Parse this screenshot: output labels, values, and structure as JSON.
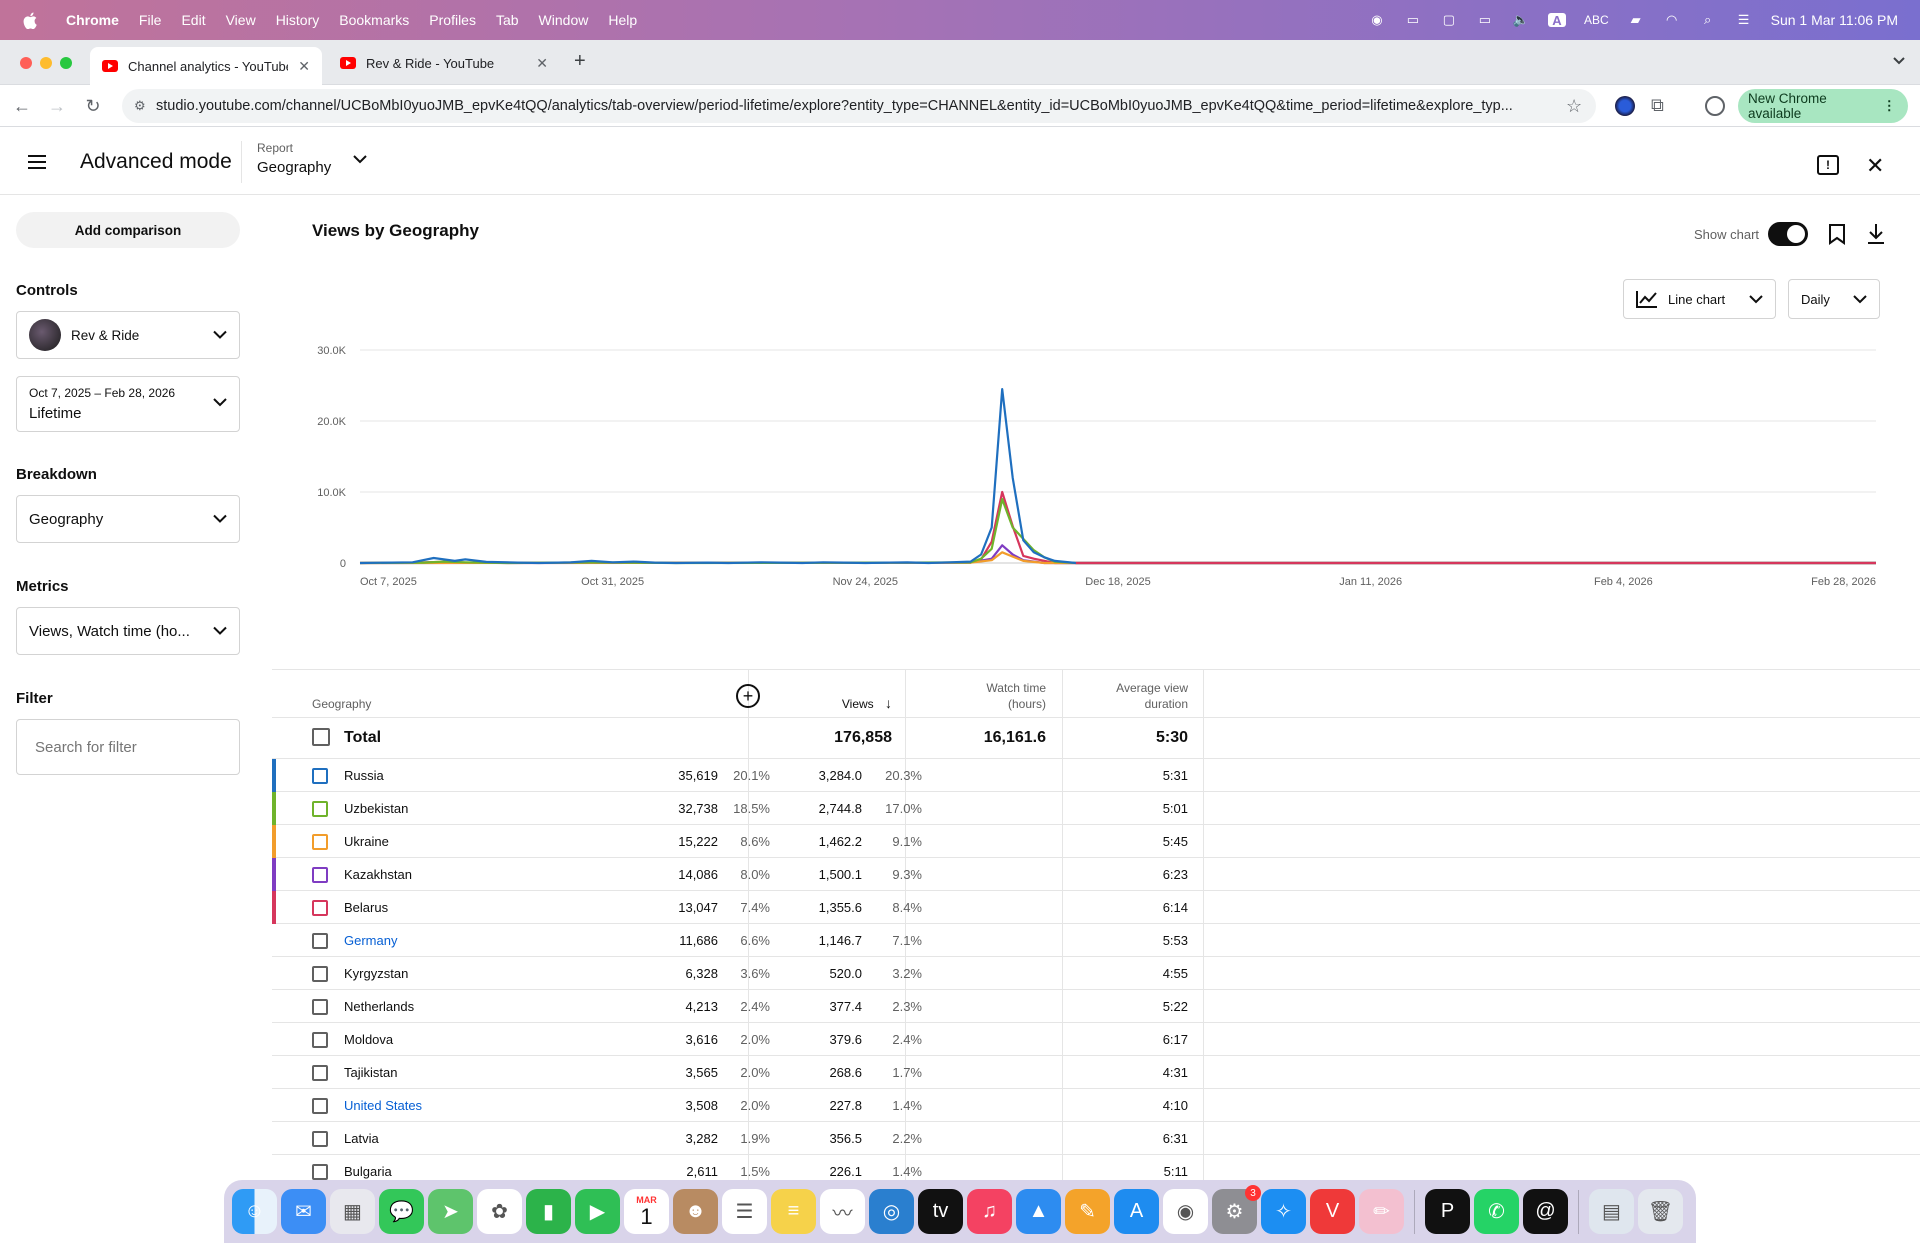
{
  "menubar": {
    "app": "Chrome",
    "items": [
      "File",
      "Edit",
      "View",
      "History",
      "Bookmarks",
      "Profiles",
      "Tab",
      "Window",
      "Help"
    ],
    "input_source": "ABC",
    "clock": "Sun 1 Mar  11:06 PM"
  },
  "tabs": [
    {
      "title": "Channel analytics - YouTube S"
    },
    {
      "title": "Rev & Ride - YouTube"
    }
  ],
  "address": {
    "url": "studio.youtube.com/channel/UCBoMbI0yuoJMB_epvKe4tQQ/analytics/tab-overview/period-lifetime/explore?entity_type=CHANNEL&entity_id=UCBoMbI0yuoJMB_epvKe4tQQ&time_period=lifetime&explore_typ...",
    "new_chrome": "New Chrome available"
  },
  "header": {
    "title": "Advanced mode",
    "report_label": "Report",
    "report_value": "Geography"
  },
  "sidebar": {
    "add_comparison": "Add comparison",
    "controls_heading": "Controls",
    "channel": "Rev & Ride",
    "date_range": "Oct 7, 2025 – Feb 28, 2026",
    "period": "Lifetime",
    "breakdown_heading": "Breakdown",
    "breakdown_value": "Geography",
    "metrics_heading": "Metrics",
    "metrics_value": "Views, Watch time (ho...",
    "filter_heading": "Filter",
    "filter_placeholder": "Search for filter"
  },
  "chart_header": {
    "title": "Views by Geography",
    "show_chart": "Show chart",
    "chart_type": "Line chart",
    "granularity": "Daily"
  },
  "chart_data": {
    "type": "line",
    "y_ticks": [
      "30.0K",
      "20.0K",
      "10.0K",
      "0"
    ],
    "ylim": [
      0,
      30000
    ],
    "x_ticks": [
      "Oct 7, 2025",
      "Oct 31, 2025",
      "Nov 24, 2025",
      "Dec 18, 2025",
      "Jan 11, 2026",
      "Feb 4, 2026",
      "Feb 28, 2026"
    ],
    "x_range_days": [
      0,
      144
    ],
    "series": [
      {
        "name": "Russia",
        "color": "#1f6fbf",
        "points": [
          [
            0,
            0
          ],
          [
            5,
            100
          ],
          [
            7,
            700
          ],
          [
            9,
            300
          ],
          [
            10,
            500
          ],
          [
            12,
            150
          ],
          [
            15,
            50
          ],
          [
            17,
            0
          ],
          [
            20,
            80
          ],
          [
            22,
            300
          ],
          [
            24,
            100
          ],
          [
            26,
            200
          ],
          [
            28,
            50
          ],
          [
            30,
            0
          ],
          [
            33,
            50
          ],
          [
            35,
            0
          ],
          [
            38,
            100
          ],
          [
            40,
            50
          ],
          [
            42,
            0
          ],
          [
            44,
            100
          ],
          [
            46,
            50
          ],
          [
            48,
            0
          ],
          [
            50,
            60
          ],
          [
            52,
            80
          ],
          [
            54,
            0
          ],
          [
            56,
            100
          ],
          [
            58,
            200
          ],
          [
            59,
            1200
          ],
          [
            60,
            5000
          ],
          [
            61,
            24500
          ],
          [
            62,
            12000
          ],
          [
            63,
            3200
          ],
          [
            64,
            1500
          ],
          [
            65,
            800
          ],
          [
            66,
            300
          ],
          [
            68,
            0
          ],
          [
            144,
            0
          ]
        ]
      },
      {
        "name": "Uzbekistan",
        "color": "#6fb32b",
        "points": [
          [
            0,
            0
          ],
          [
            6,
            60
          ],
          [
            8,
            200
          ],
          [
            10,
            100
          ],
          [
            14,
            0
          ],
          [
            22,
            80
          ],
          [
            26,
            50
          ],
          [
            30,
            0
          ],
          [
            52,
            50
          ],
          [
            58,
            80
          ],
          [
            59,
            600
          ],
          [
            60,
            2000
          ],
          [
            61,
            9000
          ],
          [
            62,
            5000
          ],
          [
            63,
            3400
          ],
          [
            64,
            1800
          ],
          [
            65,
            800
          ],
          [
            66,
            200
          ],
          [
            68,
            0
          ],
          [
            144,
            0
          ]
        ]
      },
      {
        "name": "Ukraine",
        "color": "#f29d2b",
        "points": [
          [
            0,
            0
          ],
          [
            58,
            50
          ],
          [
            60,
            400
          ],
          [
            61,
            1500
          ],
          [
            62,
            900
          ],
          [
            63,
            300
          ],
          [
            65,
            0
          ],
          [
            144,
            0
          ]
        ]
      },
      {
        "name": "Kazakhstan",
        "color": "#7f3cc2",
        "points": [
          [
            0,
            0
          ],
          [
            58,
            50
          ],
          [
            60,
            600
          ],
          [
            61,
            2500
          ],
          [
            62,
            1200
          ],
          [
            63,
            400
          ],
          [
            65,
            0
          ],
          [
            144,
            0
          ]
        ]
      },
      {
        "name": "Belarus",
        "color": "#d6365c",
        "points": [
          [
            0,
            0
          ],
          [
            5,
            50
          ],
          [
            8,
            150
          ],
          [
            10,
            50
          ],
          [
            14,
            0
          ],
          [
            58,
            50
          ],
          [
            59,
            500
          ],
          [
            60,
            3000
          ],
          [
            61,
            10000
          ],
          [
            62,
            5200
          ],
          [
            63,
            1000
          ],
          [
            64,
            600
          ],
          [
            66,
            0
          ],
          [
            144,
            0
          ]
        ]
      }
    ]
  },
  "table": {
    "headers": {
      "geography": "Geography",
      "views": "Views",
      "watch_time_1": "Watch time",
      "watch_time_2": "(hours)",
      "avd_1": "Average view",
      "avd_2": "duration"
    },
    "total": {
      "label": "Total",
      "views": "176,858",
      "watch": "16,161.6",
      "avd": "5:30"
    },
    "rows": [
      {
        "name": "Russia",
        "views": "35,619",
        "vp": "20.1%",
        "watch": "3,284.0",
        "wp": "20.3%",
        "avd": "5:31",
        "color": "#1f6fbf",
        "link": false
      },
      {
        "name": "Uzbekistan",
        "views": "32,738",
        "vp": "18.5%",
        "watch": "2,744.8",
        "wp": "17.0%",
        "avd": "5:01",
        "color": "#6fb32b",
        "link": false
      },
      {
        "name": "Ukraine",
        "views": "15,222",
        "vp": "8.6%",
        "watch": "1,462.2",
        "wp": "9.1%",
        "avd": "5:45",
        "color": "#f29d2b",
        "link": false
      },
      {
        "name": "Kazakhstan",
        "views": "14,086",
        "vp": "8.0%",
        "watch": "1,500.1",
        "wp": "9.3%",
        "avd": "6:23",
        "color": "#7f3cc2",
        "link": false
      },
      {
        "name": "Belarus",
        "views": "13,047",
        "vp": "7.4%",
        "watch": "1,355.6",
        "wp": "8.4%",
        "avd": "6:14",
        "color": "#d6365c",
        "link": false
      },
      {
        "name": "Germany",
        "views": "11,686",
        "vp": "6.6%",
        "watch": "1,146.7",
        "wp": "7.1%",
        "avd": "5:53",
        "color": "",
        "link": true
      },
      {
        "name": "Kyrgyzstan",
        "views": "6,328",
        "vp": "3.6%",
        "watch": "520.0",
        "wp": "3.2%",
        "avd": "4:55",
        "color": "",
        "link": false
      },
      {
        "name": "Netherlands",
        "views": "4,213",
        "vp": "2.4%",
        "watch": "377.4",
        "wp": "2.3%",
        "avd": "5:22",
        "color": "",
        "link": false
      },
      {
        "name": "Moldova",
        "views": "3,616",
        "vp": "2.0%",
        "watch": "379.6",
        "wp": "2.4%",
        "avd": "6:17",
        "color": "",
        "link": false
      },
      {
        "name": "Tajikistan",
        "views": "3,565",
        "vp": "2.0%",
        "watch": "268.6",
        "wp": "1.7%",
        "avd": "4:31",
        "color": "",
        "link": false
      },
      {
        "name": "United States",
        "views": "3,508",
        "vp": "2.0%",
        "watch": "227.8",
        "wp": "1.4%",
        "avd": "4:10",
        "color": "",
        "link": true
      },
      {
        "name": "Latvia",
        "views": "3,282",
        "vp": "1.9%",
        "watch": "356.5",
        "wp": "2.2%",
        "avd": "6:31",
        "color": "",
        "link": false
      },
      {
        "name": "Bulgaria",
        "views": "2,611",
        "vp": "1.5%",
        "watch": "226.1",
        "wp": "1.4%",
        "avd": "5:11",
        "color": "",
        "link": false
      }
    ]
  },
  "dock": {
    "icons": [
      "finder-icon",
      "mail-icon",
      "launchpad-icon",
      "messages-icon",
      "maps-icon",
      "photos-icon",
      "numbers-icon",
      "facetime-icon",
      "calendar-icon",
      "contacts-icon",
      "reminders-icon",
      "notes-icon",
      "freeform-icon",
      "quicktime-icon",
      "appletv-icon",
      "music-icon",
      "keynote-icon",
      "pages-icon",
      "appstore-icon",
      "chrome-icon",
      "settings-icon",
      "safari-icon",
      "vivaldi-icon",
      "pencil-app-icon",
      "pixelmator-icon",
      "whatsapp-icon",
      "threads-icon",
      "preview-icon",
      "trash-icon"
    ],
    "calendar_month": "MAR",
    "calendar_day": "1",
    "settings_badge": "3"
  }
}
